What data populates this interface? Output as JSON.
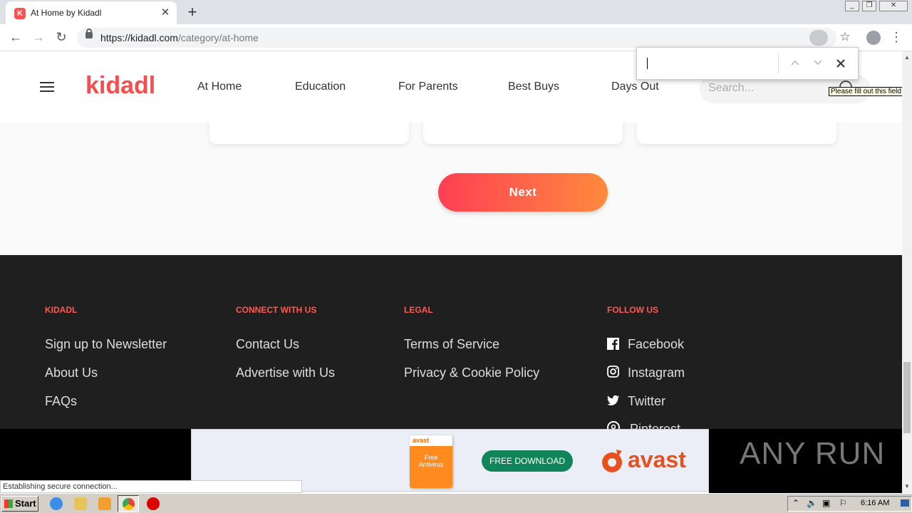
{
  "browser": {
    "tab_title": "At Home by Kidadl",
    "tab_favicon": "K",
    "url_host": "https://kidadl.com",
    "url_path": "/category/at-home",
    "new_tab": "+",
    "close_tab": "✕"
  },
  "header": {
    "logo": "kidadl",
    "nav": [
      "At Home",
      "Education",
      "For Parents",
      "Best Buys",
      "Days Out"
    ],
    "search_placeholder": "Search..."
  },
  "next_label": "Next",
  "footer": {
    "cols": [
      {
        "heading": "KIDADL",
        "links": [
          "Sign up to Newsletter",
          "About Us",
          "FAQs"
        ]
      },
      {
        "heading": "CONNECT WITH US",
        "links": [
          "Contact Us",
          "Advertise with Us"
        ]
      },
      {
        "heading": "LEGAL",
        "links": [
          "Terms of Service",
          "Privacy & Cookie Policy"
        ]
      },
      {
        "heading": "FOLLOW US",
        "links": [
          "Facebook",
          "Instagram",
          "Twitter",
          "Pinterest"
        ]
      }
    ]
  },
  "findbar": {
    "value": ""
  },
  "tooltip": "Please fill out this field.",
  "ad": {
    "box_brand": "avast",
    "box_title": "Free Antivirus",
    "download": "FREE DOWNLOAD",
    "brand": "avast"
  },
  "watermark": "ANY RUN",
  "status": "Establishing secure connection...",
  "taskbar": {
    "start": "Start",
    "clock": "6:16 AM"
  },
  "colors": {
    "brand": "#f54e4e",
    "footer_head": "#ff5a4f",
    "download": "#11855a"
  }
}
